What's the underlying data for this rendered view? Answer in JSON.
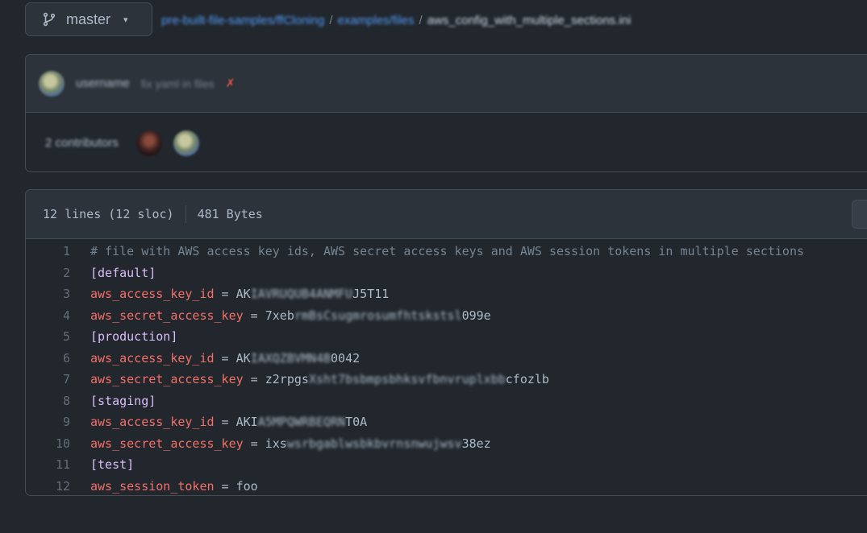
{
  "branch": {
    "label": "master",
    "icon": "git-branch-icon",
    "caret": "▾"
  },
  "breadcrumb": {
    "repo": "pre-built-file-samples/ffCloning",
    "sep1": "/",
    "dir": "examples/files",
    "sep2": "/",
    "file": "aws_config_with_multiple_sections.ini"
  },
  "commit": {
    "author": "username",
    "message": "fix yaml in files",
    "status": "✗",
    "contributors": "2 contributors"
  },
  "file_info": {
    "lines": "12 lines (12 sloc)",
    "size": "481 Bytes"
  },
  "code": [
    {
      "n": "1",
      "comment": "# file with AWS access key ids, AWS secret access keys and AWS session tokens in multiple sections"
    },
    {
      "n": "2",
      "section": "[default]"
    },
    {
      "n": "3",
      "key": "aws_access_key_id",
      "op": " = ",
      "val_prefix": "AK",
      "val_blur": "IAVRUQUB4ANMFU",
      "val_suffix": "J5T11"
    },
    {
      "n": "4",
      "key": "aws_secret_access_key",
      "op": " = ",
      "val_prefix": "7xeb",
      "val_blur": "rmBsCsugmrosumfhtskstsl",
      "val_suffix": "099e"
    },
    {
      "n": "5",
      "section": "[production]"
    },
    {
      "n": "6",
      "key": "aws_access_key_id",
      "op": " = ",
      "val_prefix": "AK",
      "val_blur": "IAXQZBVMN4B",
      "val_suffix": "0042"
    },
    {
      "n": "7",
      "key": "aws_secret_access_key",
      "op": " = ",
      "val_prefix": "z2rpgs",
      "val_blur": "Xsht7bsbmpsbhksvfbnvruplxbb",
      "val_suffix": "cfozlb"
    },
    {
      "n": "8",
      "section": "[staging]"
    },
    {
      "n": "9",
      "key": "aws_access_key_id",
      "op": " = ",
      "val_prefix": "AKI",
      "val_blur": "A5MPQWRBEQRN",
      "val_suffix": "T0A"
    },
    {
      "n": "10",
      "key": "aws_secret_access_key",
      "op": " = ",
      "val_prefix": "ixs",
      "val_blur": "wsrbgablwsbkbvrnsnwujwsv",
      "val_suffix": "38ez"
    },
    {
      "n": "11",
      "section": "[test]"
    },
    {
      "n": "12",
      "key": "aws_session_token",
      "op": " = ",
      "val_prefix": "foo",
      "val_blur": "",
      "val_suffix": ""
    }
  ]
}
